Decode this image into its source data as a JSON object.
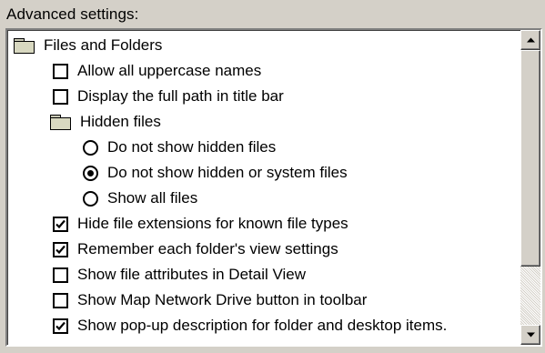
{
  "caption": "Advanced settings:",
  "items": [
    {
      "type": "folder",
      "label": "Files and Folders",
      "icon": "folder-icon"
    },
    {
      "type": "checkbox",
      "label": "Allow all uppercase names",
      "checked": false
    },
    {
      "type": "checkbox",
      "label": "Display the full path in title bar",
      "checked": false
    },
    {
      "type": "folder",
      "label": "Hidden files",
      "icon": "folder-icon"
    },
    {
      "type": "radio",
      "label": "Do not show hidden files",
      "selected": false
    },
    {
      "type": "radio",
      "label": "Do not show hidden or system files",
      "selected": true
    },
    {
      "type": "radio",
      "label": "Show all files",
      "selected": false
    },
    {
      "type": "checkbox",
      "label": "Hide file extensions for known file types",
      "checked": true
    },
    {
      "type": "checkbox",
      "label": "Remember each folder's view settings",
      "checked": true
    },
    {
      "type": "checkbox",
      "label": "Show file attributes in Detail View",
      "checked": false
    },
    {
      "type": "checkbox",
      "label": "Show Map Network Drive button in toolbar",
      "checked": false
    },
    {
      "type": "checkbox",
      "label": "Show pop-up description for folder and desktop items.",
      "checked": true
    }
  ],
  "scrollbar": {
    "up_icon": "scroll-up-arrow-icon",
    "down_icon": "scroll-down-arrow-icon",
    "position": 0
  },
  "colors": {
    "dialog_background": "#d4d0c8",
    "list_background": "#ffffff"
  }
}
